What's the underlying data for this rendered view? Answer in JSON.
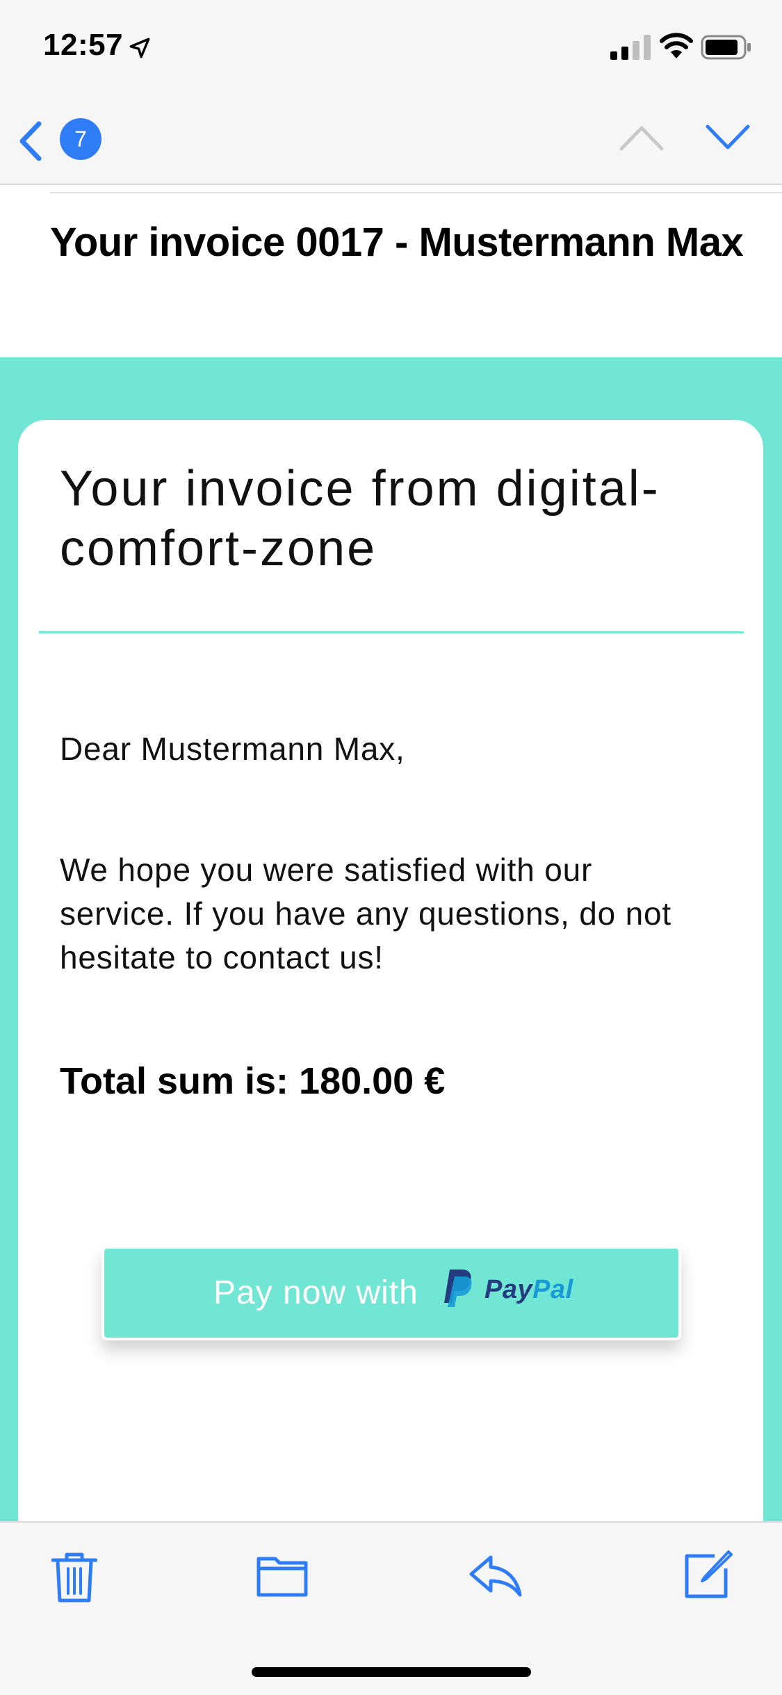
{
  "status_bar": {
    "time": "12:57",
    "icons": [
      "location-arrow-icon",
      "cellular-signal-icon",
      "wifi-icon",
      "battery-icon"
    ]
  },
  "nav": {
    "back_icon": "chevron-left-icon",
    "unread_count": "7",
    "prev_icon": "chevron-up-icon",
    "next_icon": "chevron-down-icon"
  },
  "email": {
    "subject": "Your invoice 0017 - Mustermann Max",
    "card_title": "Your invoice from digital-comfort-zone",
    "greeting": "Dear Mustermann Max,",
    "message": "We hope you were satisfied with our service. If you have any questions, do not hesitate to contact us!",
    "total": "Total sum is: 180.00 €",
    "pay_button": {
      "label": "Pay now with",
      "brand_pay": "Pay",
      "brand_pal": "Pal"
    }
  },
  "toolbar": {
    "icons": [
      "trash-icon",
      "folder-icon",
      "reply-icon",
      "compose-icon"
    ]
  },
  "colors": {
    "accent": "#2f7df6",
    "email_background": "#72e6d4",
    "paypal_dark": "#253b80",
    "paypal_light": "#179bd7"
  }
}
